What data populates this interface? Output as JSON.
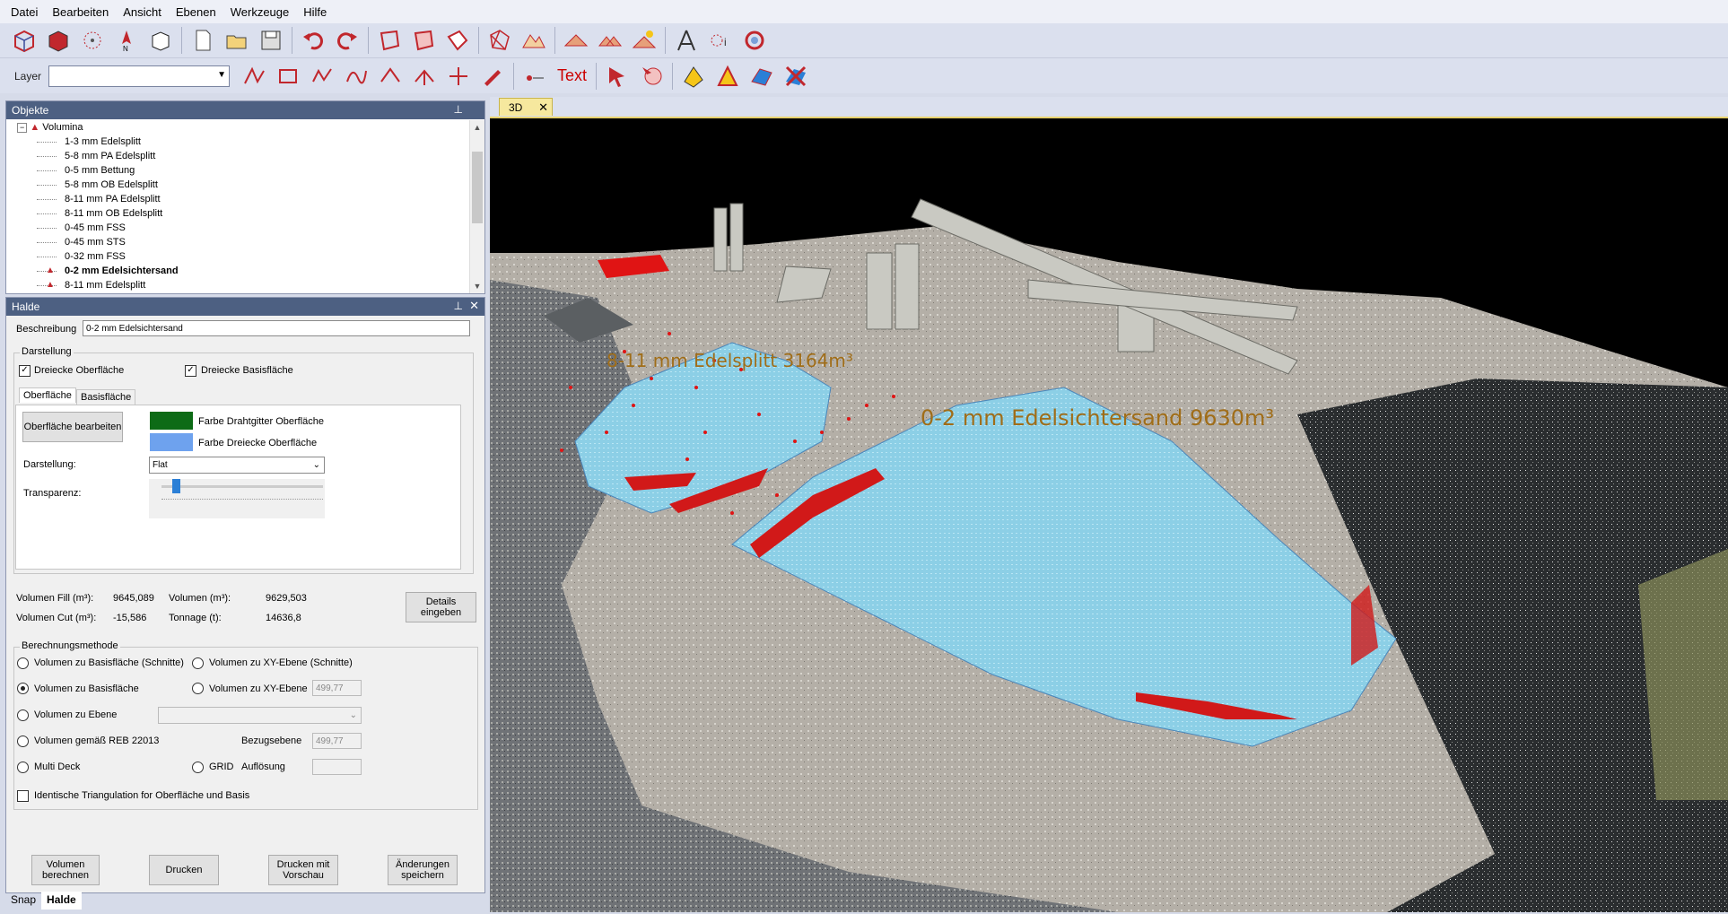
{
  "menu": [
    "Datei",
    "Bearbeiten",
    "Ansicht",
    "Ebenen",
    "Werkzeuge",
    "Hilfe"
  ],
  "toolbar2": {
    "layer_label": "Layer",
    "layer_value": "",
    "text_tool": "Text"
  },
  "objekte": {
    "title": "Objekte",
    "root": "Volumina",
    "items": [
      "1-3 mm Edelsplitt",
      "5-8 mm PA Edelsplitt",
      "0-5 mm Bettung",
      "5-8 mm OB Edelsplitt",
      "8-11 mm PA Edelsplitt",
      "8-11 mm OB Edelsplitt",
      "0-45 mm FSS",
      "0-45 mm STS",
      "0-32 mm FSS",
      "0-2 mm Edelsichtersand",
      "8-11 mm Edelsplitt"
    ]
  },
  "halde": {
    "title": "Halde",
    "beschreibung_label": "Beschreibung",
    "beschreibung_value": "0-2 mm Edelsichtersand",
    "darstellung_group": "Darstellung",
    "chk_oberflaeche": "Dreiecke Oberfläche",
    "chk_basis": "Dreiecke Basisfläche",
    "tab_oberflaeche": "Oberfläche",
    "tab_basis": "Basisfläche",
    "btn_bearbeiten": "Oberfläche bearbeiten",
    "farbe_draht": "Farbe Drahtgitter Oberfläche",
    "farbe_dreiecke": "Farbe Dreiecke Oberfläche",
    "darstellung_label": "Darstellung:",
    "darstellung_value": "Flat",
    "transparenz_label": "Transparenz:",
    "vol_fill_label": "Volumen Fill (m³):",
    "vol_fill_value": "9645,089",
    "vol_cut_label": "Volumen Cut (m³):",
    "vol_cut_value": "-15,586",
    "volumen_label": "Volumen (m³):",
    "volumen_value": "9629,503",
    "tonnage_label": "Tonnage (t):",
    "tonnage_value": "14636,8",
    "btn_details": "Details eingeben",
    "methode_group": "Berechnungsmethode",
    "r1": "Volumen zu Basisfläche (Schnitte)",
    "r2": "Volumen zu XY-Ebene (Schnitte)",
    "r3": "Volumen zu Basisfläche",
    "r4": "Volumen zu XY-Ebene",
    "r4_value": "499,77",
    "r5": "Volumen zu Ebene",
    "r6": "Volumen gemäß REB 22013",
    "bezug_label": "Bezugsebene",
    "bezug_value": "499,77",
    "r7": "Multi Deck",
    "r8": "GRID",
    "aufloesung_label": "Auflösung",
    "chk_ident": "Identische Triangulation for Oberfläche und Basis",
    "btn_berechnen": "Volumen berechnen",
    "btn_drucken": "Drucken",
    "btn_vorschau": "Drucken mit Vorschau",
    "btn_speichern": "Änderungen speichern"
  },
  "bottom_tabs": [
    "Snap",
    "Halde"
  ],
  "doc_tab": "3D",
  "viewport": {
    "label1": "8-11 mm Edelsplitt  3164m³",
    "label2": "0-2  mm  Edelsichtersand  9630m³"
  },
  "colors": {
    "drahtgitter": "#0d6b16",
    "dreiecke": "#6ea2ee",
    "accent_tab": "#f6e89e"
  }
}
